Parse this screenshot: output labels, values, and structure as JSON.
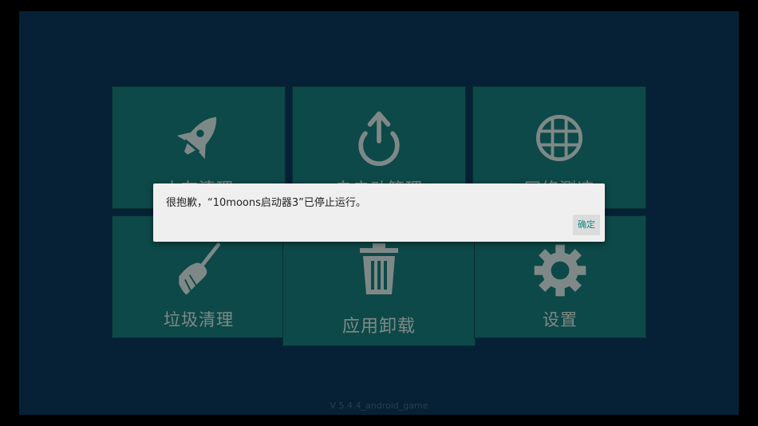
{
  "tiles": [
    {
      "label": "内存清理",
      "icon": "rocket-icon"
    },
    {
      "label": "自启动管理",
      "icon": "power-icon"
    },
    {
      "label": "网络测速",
      "icon": "grid-icon"
    },
    {
      "label": "垃圾清理",
      "icon": "broom-icon"
    },
    {
      "label": "应用卸载",
      "icon": "trash-icon"
    },
    {
      "label": "设置",
      "icon": "gear-icon"
    }
  ],
  "version": "V 5.4.4_android_game",
  "dialog": {
    "message": "很抱歉，“10moons启动器3”已停止运行。",
    "ok_label": "确定"
  },
  "colors": {
    "background": "#0c3a5e",
    "tile": "#177f7c",
    "accent": "#168a82"
  }
}
